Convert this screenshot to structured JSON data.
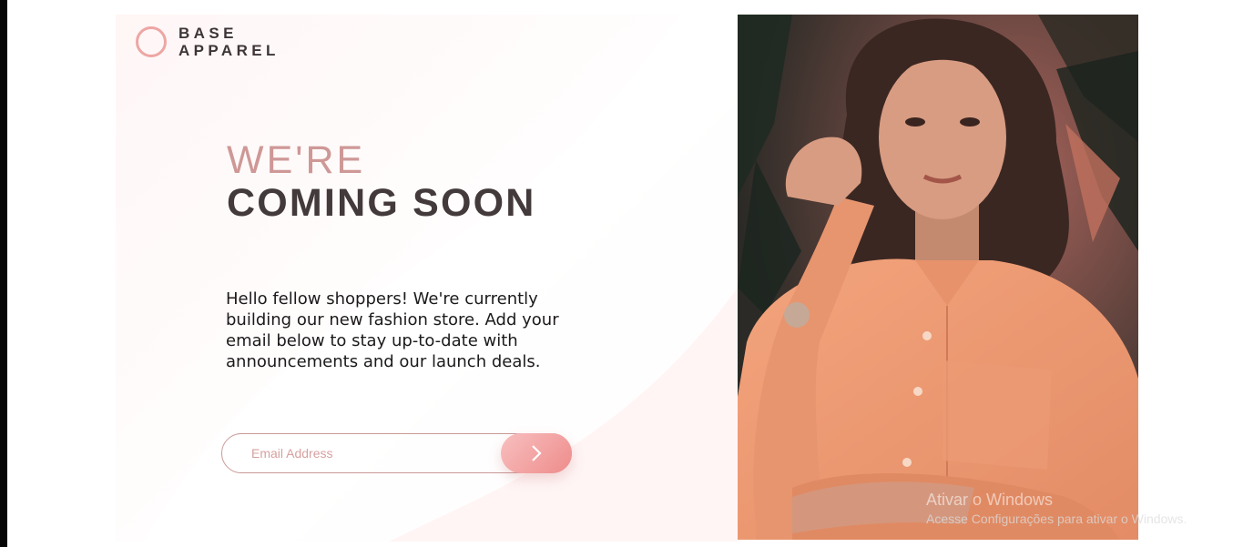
{
  "brand": {
    "line1": "BASE",
    "line2": "APPAREL",
    "accent_color": "#eda6a4"
  },
  "hero": {
    "heading_light": "WE'RE",
    "heading_bold": "COMING SOON",
    "description": "Hello fellow shoppers! We're currently building our new fashion store. Add your email below to stay up-to-date with announcements and our launch deals."
  },
  "form": {
    "email_placeholder": "Email Address",
    "email_value": "",
    "submit_icon": "chevron-right-icon"
  },
  "hero_image": {
    "subject": "woman-in-orange-shirt"
  },
  "windows_activation": {
    "title": "Ativar o Windows",
    "subtitle": "Acesse Configurações para ativar o Windows."
  },
  "colors": {
    "primary_text": "#433a3b",
    "desaturated_red": "#ce9896",
    "gradient_start": "#f8bfbf",
    "gradient_end": "#ee8c8b"
  }
}
